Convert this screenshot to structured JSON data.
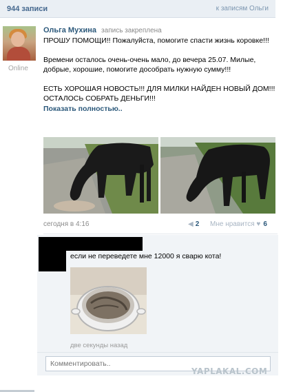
{
  "header": {
    "count": "944 записи",
    "link": "к записям Ольги"
  },
  "profile": {
    "status": "Online"
  },
  "post": {
    "author": "Ольга Мухина",
    "pinned": "запись закреплена",
    "text": "ПРОШУ ПОМОЩИ!! Пожалуйста, помогите спасти жизнь коровке!!!\n\nВремени осталось очень-очень мало, до вечера 25.07. Милые, добрые, хорошие, помогите дособрать нужную сумму!!!\n\nЕСТЬ ХОРОШАЯ НОВОСТЬ!!! ДЛЯ МИЛКИ НАЙДЕН НОВЫЙ ДОМ!!! ОСТАЛОСЬ СОБРАТЬ ДЕНЬГИ!!!",
    "more": "Показать полностью..",
    "date": "сегодня в 4:16",
    "reposts": "2",
    "likes_label": "Мне нравится",
    "likes": "6"
  },
  "comment": {
    "text": "если не переведете мне 12000 я сварю кота!",
    "time": "две секунды назад"
  },
  "input": {
    "placeholder": "Комментировать.."
  },
  "watermark": "YAPLAKAL.COM",
  "colors": {
    "link": "#2b587a",
    "header_bg": "#eaeff4",
    "comment_bg": "#f1f4f7"
  }
}
